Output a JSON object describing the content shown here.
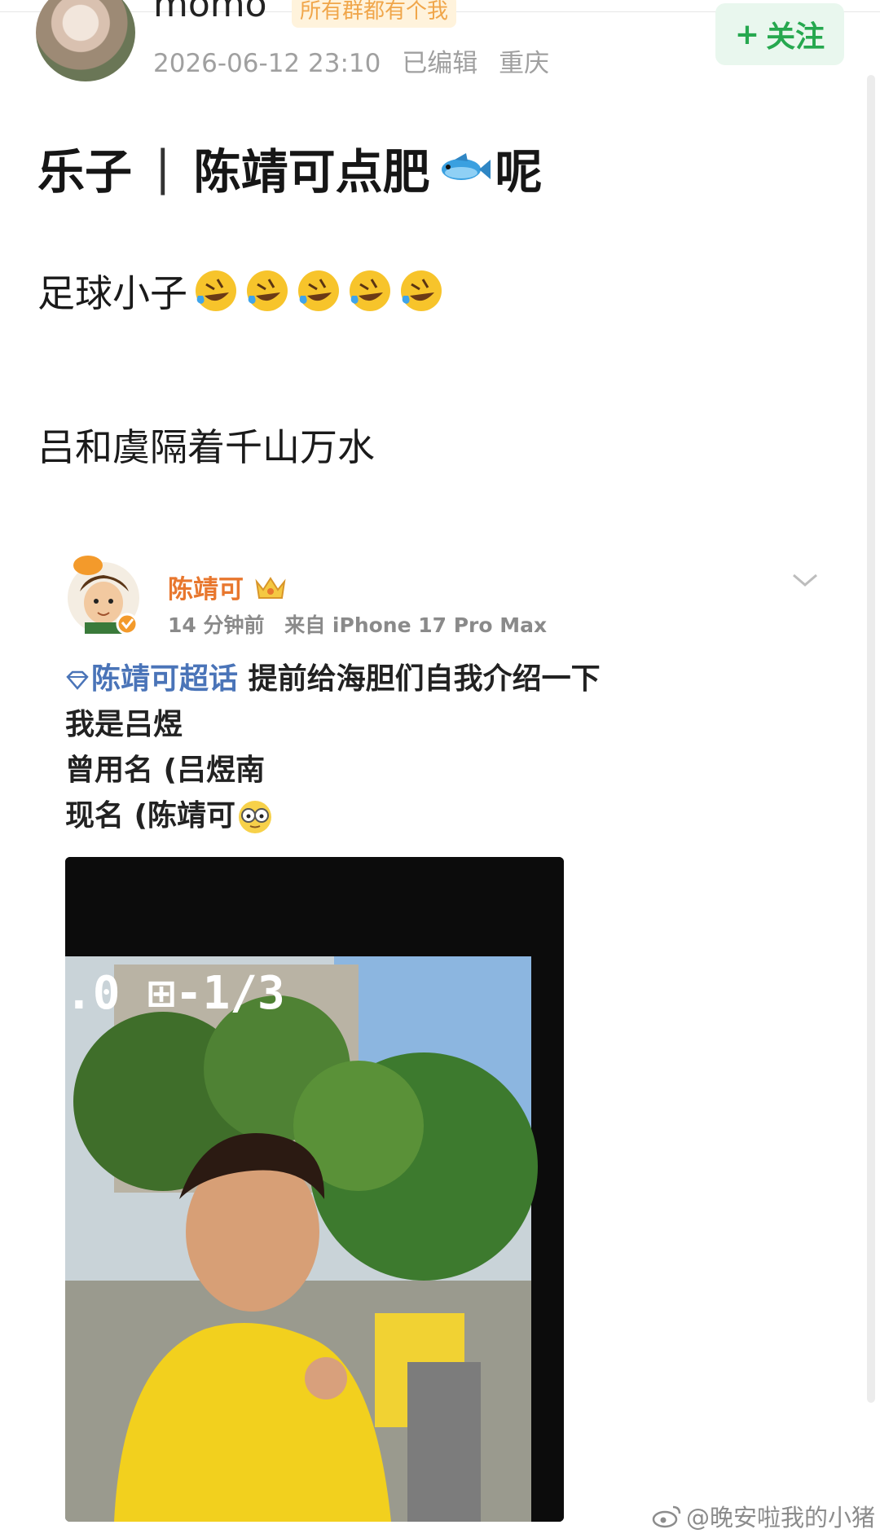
{
  "header": {
    "username": "momo",
    "badge": "所有群都有个我",
    "timestamp": "2026-06-12 23:10",
    "edited": "已编辑",
    "location": "重庆",
    "follow_label": "关注",
    "follow_plus": "+"
  },
  "post": {
    "title_left": "乐子",
    "title_sep": "|",
    "title_main": "陈靖可点肥",
    "title_tail": "呢",
    "line1": "足球小子",
    "line2": "吕和虞隔着千山万水"
  },
  "quoted": {
    "author": "陈靖可",
    "time": "14 分钟前",
    "source": "来自 iPhone 17 Pro Max",
    "topic": "陈靖可超话",
    "lines": [
      "提前给海胆们自我介绍一下",
      "我是吕煜",
      "曾用名 (吕煜南",
      "现名 (陈靖可"
    ],
    "photo_overlay": ".0 ⊞-1/3"
  },
  "watermark": "@晚安啦我的小猪",
  "colors": {
    "follow_green": "#26a84f",
    "author_orange": "#e8772e",
    "topic_blue": "#4a74b8",
    "meta_gray": "#a0a0a0"
  },
  "icons": [
    "fish-icon",
    "laughing-tears-emoji",
    "crown-icon",
    "chevron-down-icon",
    "diamond-icon",
    "glasses-emoji",
    "weibo-icon"
  ]
}
